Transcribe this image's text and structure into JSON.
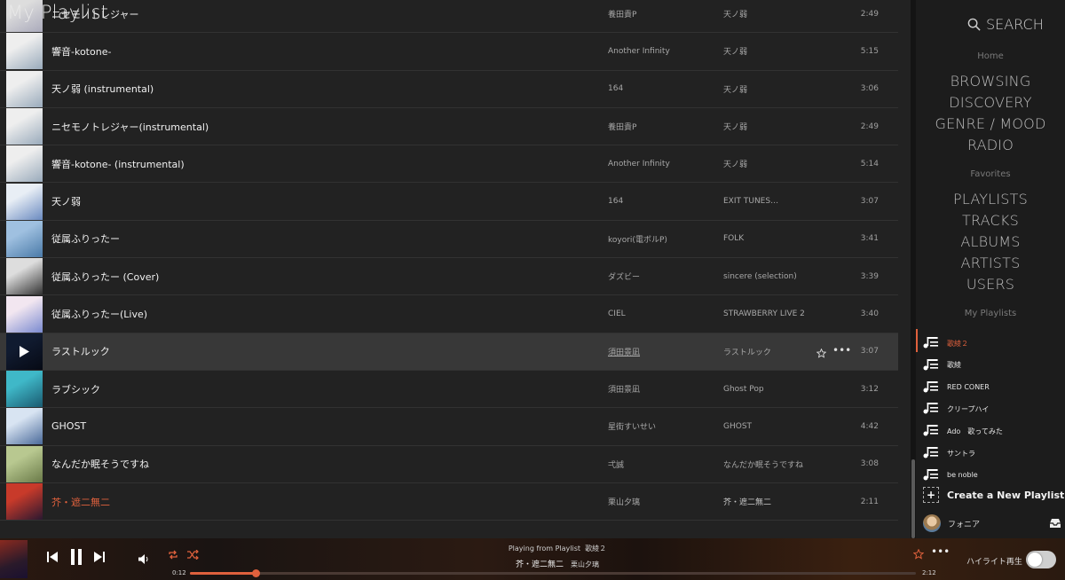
{
  "page": {
    "title": "My Playlist"
  },
  "tracks": [
    {
      "title": "ニセモノトレジャー",
      "artist": "養田貴P",
      "album": "天ノ弱",
      "duration": "2:49",
      "art": [
        "#ddd",
        "#aab"
      ]
    },
    {
      "title": "響音-kotone-",
      "artist": "Another Infinity",
      "album": "天ノ弱",
      "duration": "5:15",
      "art": [
        "#eee",
        "#9ab"
      ]
    },
    {
      "title": "天ノ弱 (instrumental)",
      "artist": "164",
      "album": "天ノ弱",
      "duration": "3:06",
      "art": [
        "#eee",
        "#9ab"
      ]
    },
    {
      "title": "ニセモノトレジャー(instrumental)",
      "artist": "養田貴P",
      "album": "天ノ弱",
      "duration": "2:49",
      "art": [
        "#eee",
        "#9ab"
      ]
    },
    {
      "title": "響音-kotone- (instrumental)",
      "artist": "Another Infinity",
      "album": "天ノ弱",
      "duration": "5:14",
      "art": [
        "#eee",
        "#9ab"
      ]
    },
    {
      "title": "天ノ弱",
      "artist": "164",
      "album": "EXIT TUNES…",
      "duration": "3:07",
      "art": [
        "#e8eef5",
        "#6a8ac0"
      ]
    },
    {
      "title": "従属ふりったー",
      "artist": "koyori(電ボルP)",
      "album": "FOLK",
      "duration": "3:41",
      "art": [
        "#9fc0e0",
        "#4a7aa8"
      ]
    },
    {
      "title": "従属ふりったー (Cover)",
      "artist": "ダズビー",
      "album": "sincere (selection)",
      "duration": "3:39",
      "art": [
        "#ddd",
        "#333"
      ]
    },
    {
      "title": "従属ふりったー(Live)",
      "artist": "CIEL",
      "album": "STRAWBERRY LIVE 2",
      "duration": "3:40",
      "art": [
        "#f2e6f0",
        "#7a8ad0"
      ]
    },
    {
      "title": "ラストルック",
      "artist": "須田景凪",
      "album": "ラストルック",
      "duration": "3:07",
      "art": [
        "#1a2a4a",
        "#0a1020"
      ]
    },
    {
      "title": "ラブシック",
      "artist": "須田景凪",
      "album": "Ghost Pop",
      "duration": "3:12",
      "art": [
        "#3fb8c8",
        "#1a5a70"
      ]
    },
    {
      "title": "GHOST",
      "artist": "星街すいせい",
      "album": "GHOST",
      "duration": "4:42",
      "art": [
        "#d8e4f2",
        "#4a6a9a"
      ]
    },
    {
      "title": "なんだか眠そうですね",
      "artist": "弌誠",
      "album": "なんだか眠そうですね",
      "duration": "3:08",
      "art": [
        "#b8c890",
        "#6a7a48"
      ]
    },
    {
      "title": "芥・遮二無二",
      "artist": "栗山夕璃",
      "album": "芥・遮二無二",
      "duration": "2:11",
      "art": [
        "#c83a2a",
        "#2a1830"
      ]
    }
  ],
  "active_row_index": 9,
  "now_playing_row_index": 13,
  "sidebar": {
    "search_label": "SEARCH",
    "home_heading": "Home",
    "home_links": [
      "BROWSING",
      "DISCOVERY",
      "GENRE / MOOD",
      "RADIO"
    ],
    "favorites_heading": "Favorites",
    "favorites_links": [
      "PLAYLISTS",
      "TRACKS",
      "ALBUMS",
      "ARTISTS",
      "USERS"
    ],
    "my_playlists_heading": "My Playlists",
    "playlists": [
      "歌綾２",
      "歌綾",
      "RED CONER",
      "クリープハイ",
      "Ado　歌ってみた",
      "サントラ",
      "be noble"
    ],
    "create_label": "Create a New Playlist",
    "user_name": "フォニア"
  },
  "player": {
    "playing_from": "Playing from Playlist",
    "playlist_name": "歌綾２",
    "track_title": "芥・遮二無二",
    "track_artist": "栗山夕璃",
    "elapsed": "0:12",
    "total": "2:12",
    "progress": 0.09,
    "highlight_label": "ハイライト再生",
    "highlight_on": false
  },
  "colors": {
    "accent": "#e0613d",
    "bg_main": "#222222",
    "bg_sidebar": "#1c1c1c"
  }
}
